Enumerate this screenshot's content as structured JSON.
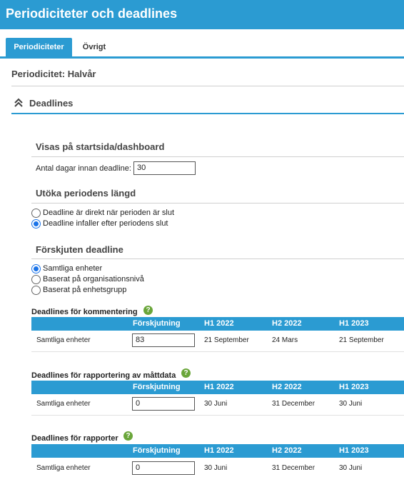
{
  "header": {
    "title": "Periodiciteter och deadlines"
  },
  "tabs": [
    {
      "label": "Periodiciteter",
      "active": true
    },
    {
      "label": "Övrigt",
      "active": false
    }
  ],
  "period": {
    "label": "Periodicitet: Halvår"
  },
  "deadlines_section": {
    "label": "Deadlines",
    "icon": "double-chevron-up-icon",
    "expanded": true
  },
  "dashboard": {
    "title": "Visas på startsida/dashboard",
    "days_label": "Antal dagar innan deadline:",
    "days_value": "30"
  },
  "extend": {
    "title": "Utöka periodens längd",
    "options": [
      {
        "label": "Deadline är direkt när perioden är slut",
        "checked": false
      },
      {
        "label": "Deadline infaller efter periodens slut",
        "checked": true
      }
    ]
  },
  "shifted": {
    "title": "Förskjuten deadline",
    "options": [
      {
        "label": "Samtliga enheter",
        "checked": true
      },
      {
        "label": "Baserat på organisationsnivå",
        "checked": false
      },
      {
        "label": "Baserat på enhetsgrupp",
        "checked": false
      }
    ]
  },
  "tables": [
    {
      "title": "Deadlines för kommentering",
      "help_icon": "?",
      "columns": [
        "Förskjutning",
        "H1 2022",
        "H2 2022",
        "H1 2023"
      ],
      "row": {
        "label": "Samtliga enheter",
        "offset": "83",
        "dates": [
          "21 September",
          "24 Mars",
          "21 September"
        ]
      }
    },
    {
      "title": "Deadlines för rapportering av måttdata",
      "help_icon": "?",
      "columns": [
        "Förskjutning",
        "H1 2022",
        "H2 2022",
        "H1 2023"
      ],
      "row": {
        "label": "Samtliga enheter",
        "offset": "0",
        "dates": [
          "30 Juni",
          "31 December",
          "30 Juni"
        ]
      }
    },
    {
      "title": "Deadlines för rapporter",
      "help_icon": "?",
      "columns": [
        "Förskjutning",
        "H1 2022",
        "H2 2022",
        "H1 2023"
      ],
      "row": {
        "label": "Samtliga enheter",
        "offset": "0",
        "dates": [
          "30 Juni",
          "31 December",
          "30 Juni"
        ]
      }
    }
  ],
  "colors": {
    "accent": "#2b9bd2",
    "help": "#6aa63a",
    "radio": "#1a73e8"
  }
}
